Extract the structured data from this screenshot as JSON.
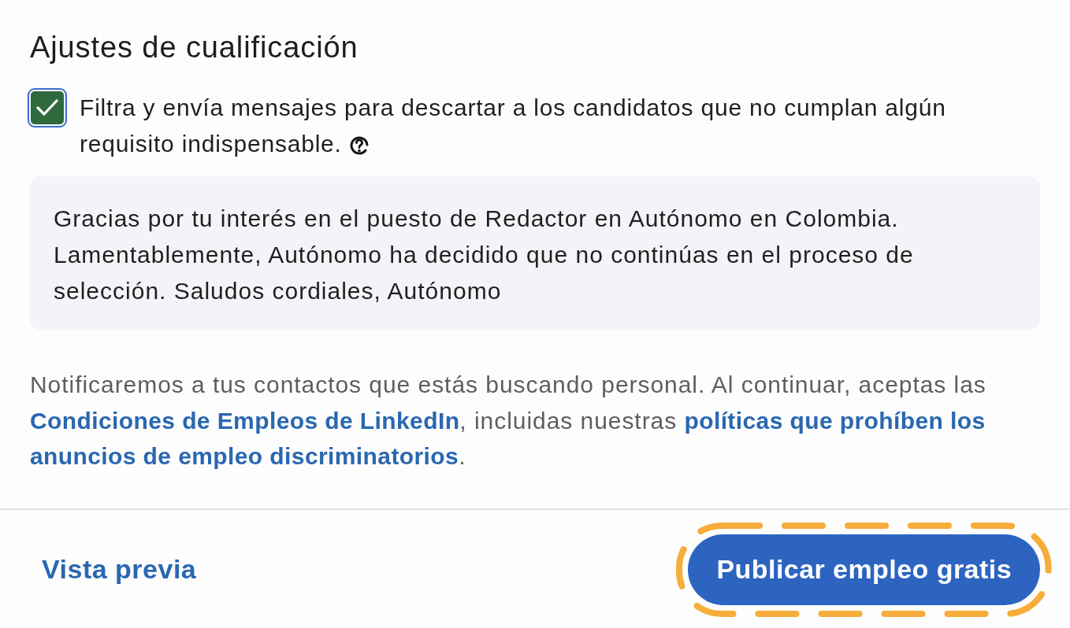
{
  "section": {
    "title": "Ajustes de cualificación"
  },
  "filter_option": {
    "label": "Filtra y envía mensajes para descartar a los candidatos que no cumplan algún requisito indispensable.",
    "checked": true,
    "focused": true
  },
  "rejection_message": {
    "text": "Gracias por tu interés en el puesto de Redactor en Autónomo en Colombia. Lamentablemente, Autónomo ha decidido que no continúas en el proceso de selección. Saludos cordiales, Autónomo"
  },
  "notice": {
    "parts": [
      {
        "kind": "text",
        "text": "Notificaremos a tus contactos que estás buscando personal. Al continuar, aceptas las "
      },
      {
        "kind": "link",
        "text": "Condiciones de Empleos de LinkedIn"
      },
      {
        "kind": "text",
        "text": ", incluidas nuestras "
      },
      {
        "kind": "link",
        "text": "políticas que prohíben los"
      },
      {
        "kind": "link",
        "text": "anuncios de empleo discriminatorios"
      },
      {
        "kind": "text",
        "text": "."
      }
    ]
  },
  "footer": {
    "buttons": [
      {
        "kind": "link",
        "label": "Vista previa",
        "highlighted": false
      },
      {
        "kind": "primary",
        "label": "Publicar empleo gratis",
        "highlighted": true
      }
    ]
  }
}
